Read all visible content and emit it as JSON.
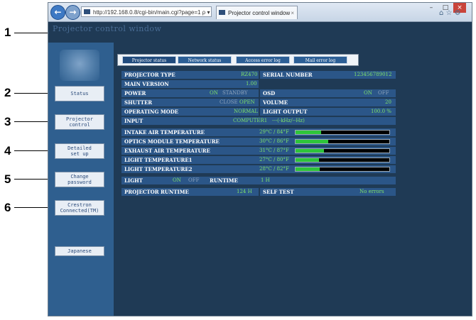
{
  "callouts": [
    "1",
    "2",
    "3",
    "4",
    "5",
    "6"
  ],
  "browser": {
    "back_icon": "back-arrow-icon",
    "forward_icon": "forward-arrow-icon",
    "address": "http://192.168.0.8/cgi-bin/main.cgi?page=1 ρ ▾ ☆",
    "tab_title": "Projector control window",
    "tab_close": "×",
    "window_controls": [
      "–",
      "□",
      "×"
    ],
    "right_icons": "⌂ ☆ ⚙"
  },
  "app_title": "Projector control window",
  "sidebar": {
    "buttons": [
      {
        "label": "Status"
      },
      {
        "label": "Projector\ncontrol"
      },
      {
        "label": "Detailed\nset up"
      },
      {
        "label": "Change\npassword"
      },
      {
        "label": "Crestron\nConnected(TM)"
      },
      {
        "label": "Japanese"
      }
    ]
  },
  "tabs": [
    {
      "label": "Projector status",
      "active": true
    },
    {
      "label": "Network status",
      "active": false
    },
    {
      "label": "Access error log",
      "active": false
    },
    {
      "label": "Mail error log",
      "active": false
    }
  ],
  "status": {
    "projector_type": {
      "label": "PROJECTOR TYPE",
      "value": "RZ470"
    },
    "serial_number": {
      "label": "SERIAL NUMBER",
      "value": "123456789012"
    },
    "main_version": {
      "label": "MAIN VERSION",
      "value": "1.00"
    },
    "power": {
      "label": "POWER",
      "on": "ON",
      "standby": "STANDBY"
    },
    "osd": {
      "label": "OSD",
      "on": "ON",
      "off": "OFF"
    },
    "shutter": {
      "label": "SHUTTER",
      "close": "CLOSE",
      "open": "OPEN"
    },
    "volume": {
      "label": "VOLUME",
      "value": "20"
    },
    "operating_mode": {
      "label": "OPERATING MODE",
      "value": "NORMAL"
    },
    "light_output": {
      "label": "LIGHT OUTPUT",
      "value": "100.0 %"
    },
    "input": {
      "label": "INPUT",
      "value": "COMPUTER1",
      "signal": "---(-kHz/--Hz)"
    },
    "temperatures": [
      {
        "label": "INTAKE AIR TEMPERATURE",
        "value": "29°C / 84°F",
        "level": 0.27
      },
      {
        "label": "OPTICS MODULE TEMPERATURE",
        "value": "30°C / 86°F",
        "level": 0.35
      },
      {
        "label": "EXHAUST AIR TEMPERATURE",
        "value": "31°C / 87°F",
        "level": 0.3
      },
      {
        "label": "LIGHT TEMPERATURE1",
        "value": "27°C / 80°F",
        "level": 0.25
      },
      {
        "label": "LIGHT TEMPERATURE2",
        "value": "28°C / 82°F",
        "level": 0.26
      }
    ],
    "light": {
      "label": "LIGHT",
      "on": "ON",
      "off": "OFF"
    },
    "runtime": {
      "label": "RUNTIME",
      "value": "1 H"
    },
    "projector_runtime": {
      "label": "PROJECTOR RUNTIME",
      "value": "124 H"
    },
    "self_test": {
      "label": "SELF TEST",
      "value": "No errors"
    }
  }
}
